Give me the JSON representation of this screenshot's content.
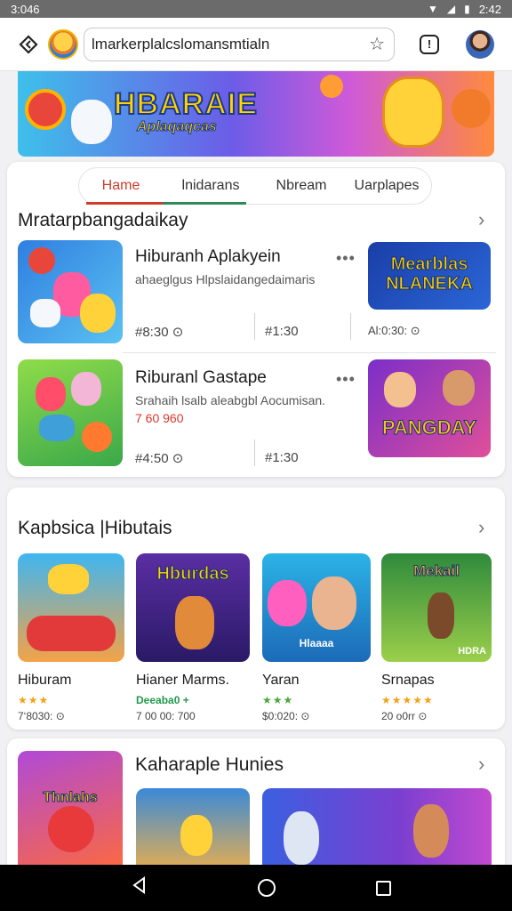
{
  "status_bar": {
    "time_left": "3:046",
    "time_right": "2:42"
  },
  "search": {
    "value": "lmarkerplalcslomansmtialn"
  },
  "hero": {
    "title": "HBARAIE",
    "subtitle": "Aplaqaqcas"
  },
  "tabs": [
    "Hame",
    "lnidarans",
    "Nbream",
    "Uarplapes"
  ],
  "section1": {
    "title": "Mratarpbangadaikay",
    "items": [
      {
        "title": "Hiburanh Aplakyein",
        "desc": "ahaeglgus Hlpslaidangedaimaris",
        "price": "",
        "meta_left": "#8:30",
        "meta_mid": "#1:30",
        "meta_right": "Al:0:30:",
        "banner": "Mearblas NLANEKA"
      },
      {
        "title": "Riburanl Gastape",
        "desc": "Srahaih lsalb aleabgbl Aocumisan.",
        "price": "7 60 960",
        "meta_left": "#4:50",
        "meta_mid": "#1:30",
        "banner": "PANGDAY"
      }
    ]
  },
  "section2": {
    "title": "Kapbsica |Hibutais",
    "games": [
      {
        "name": "Hiburam",
        "badge": "",
        "meta": "7‘8030:"
      },
      {
        "name": "Hianer Marms.",
        "badge": "Deeaba0 +",
        "meta": "7 00 00: 700"
      },
      {
        "name": "Yaran",
        "badge": "",
        "meta": "$0:020:"
      },
      {
        "name": "Srnapas",
        "badge": "",
        "meta": "20 o0rr"
      }
    ],
    "thumb_labels": [
      "Hburdas",
      "Hlaaaa",
      "Mekail",
      "HDRA"
    ]
  },
  "section3": {
    "title": "Kaharaple Hunies",
    "thumb_label": "Thnlahs"
  },
  "icons": [
    "wifi-icon",
    "signal-icon",
    "battery-icon",
    "back-icon",
    "star-icon",
    "alert-icon",
    "more-icon",
    "chevron-right-icon",
    "clock-icon",
    "nav-back-icon",
    "nav-home-icon",
    "nav-recents-icon"
  ],
  "colors": {
    "accent_red": "#d23a2a",
    "accent_green": "#2e8b57",
    "star": "#f2a21a"
  }
}
